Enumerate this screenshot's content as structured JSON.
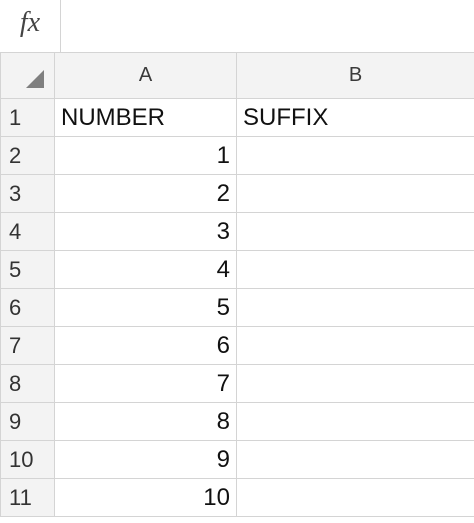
{
  "formula_bar": {
    "fx_label": "fx"
  },
  "columns": [
    "A",
    "B"
  ],
  "rows": [
    {
      "num": "1",
      "a": "NUMBER",
      "b": "SUFFIX"
    },
    {
      "num": "2",
      "a": "1",
      "b": ""
    },
    {
      "num": "3",
      "a": "2",
      "b": ""
    },
    {
      "num": "4",
      "a": "3",
      "b": ""
    },
    {
      "num": "5",
      "a": "4",
      "b": ""
    },
    {
      "num": "6",
      "a": "5",
      "b": ""
    },
    {
      "num": "7",
      "a": "6",
      "b": ""
    },
    {
      "num": "8",
      "a": "7",
      "b": ""
    },
    {
      "num": "9",
      "a": "8",
      "b": ""
    },
    {
      "num": "10",
      "a": "9",
      "b": ""
    },
    {
      "num": "11",
      "a": "10",
      "b": ""
    }
  ]
}
